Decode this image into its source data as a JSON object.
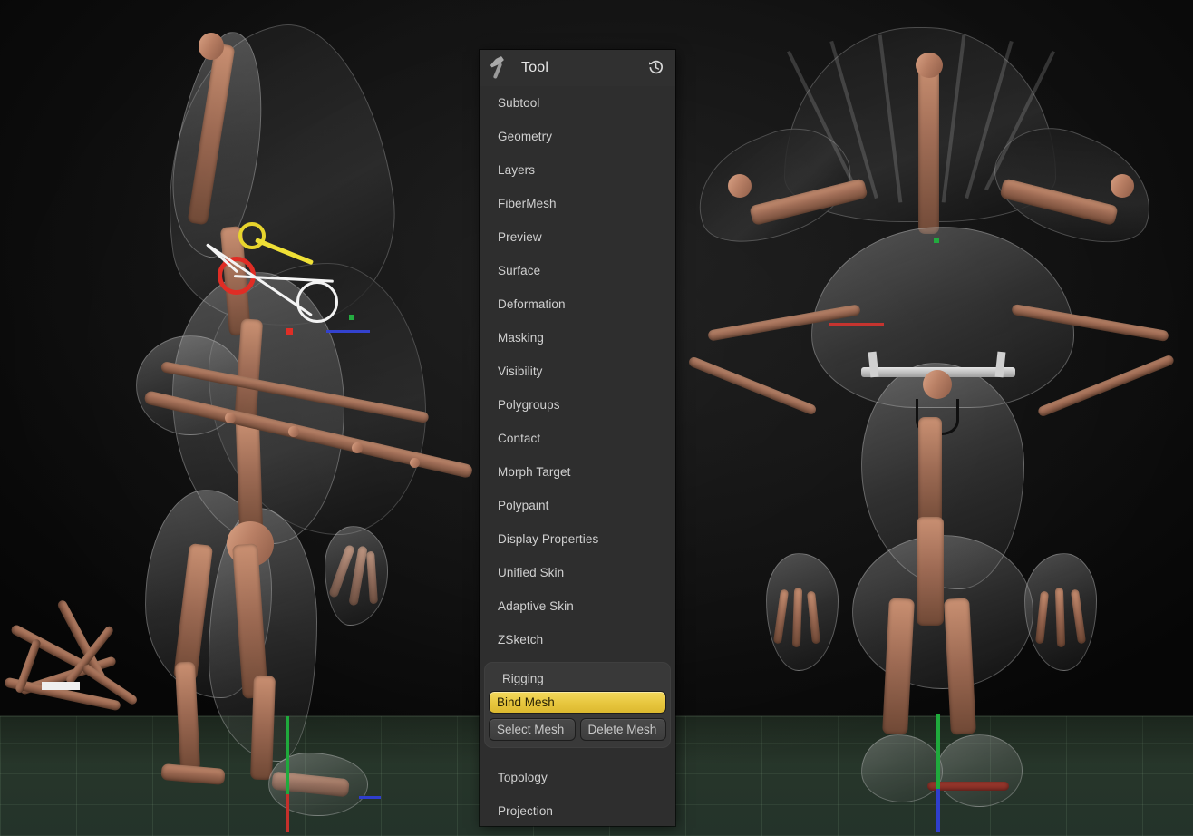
{
  "app": {
    "name": "ZBrush ZSphere Rigging",
    "viewport_background": "#121212",
    "floor_color": "#27362a"
  },
  "tool_panel": {
    "title": "Tool",
    "title_icon": "hammer-icon",
    "reset_icon": "reset-rotate-icon",
    "menu_items_top": [
      {
        "label": "Subtool"
      },
      {
        "label": "Geometry"
      },
      {
        "label": "Layers"
      },
      {
        "label": "FiberMesh"
      },
      {
        "label": "Preview"
      },
      {
        "label": "Surface"
      },
      {
        "label": "Deformation"
      },
      {
        "label": "Masking"
      },
      {
        "label": "Visibility"
      },
      {
        "label": "Polygroups"
      },
      {
        "label": "Contact"
      },
      {
        "label": "Morph Target"
      },
      {
        "label": "Polypaint"
      },
      {
        "label": "Display Properties"
      },
      {
        "label": "Unified Skin"
      },
      {
        "label": "Adaptive Skin"
      },
      {
        "label": "ZSketch"
      }
    ],
    "rigging": {
      "label": "Rigging",
      "bind_mesh_label": "Bind Mesh",
      "bind_mesh_active": true,
      "bind_mesh_color": "#e7c63e",
      "select_mesh_label": "Select Mesh",
      "delete_mesh_label": "Delete Mesh"
    },
    "menu_items_bottom": [
      {
        "label": "Topology"
      },
      {
        "label": "Projection"
      }
    ]
  },
  "viewport": {
    "left_model": {
      "name": "zsphere-rig-side-view",
      "description": "Side view of creature ZSphere armature with transparent skin preview"
    },
    "right_model": {
      "name": "zsphere-rig-front-view",
      "description": "Front view of creature ZSphere armature with fanned head crest"
    },
    "manipulator": {
      "name": "zsphere-move-gizmo",
      "red_ring_color": "#e02a22",
      "yellow_ring_color": "#e8d42a",
      "white_ring_color": "#f2f2f2"
    },
    "axis_gizmo": {
      "x_color": "#c4302b",
      "y_color": "#1faa3c",
      "z_color": "#2f3ecd"
    }
  }
}
